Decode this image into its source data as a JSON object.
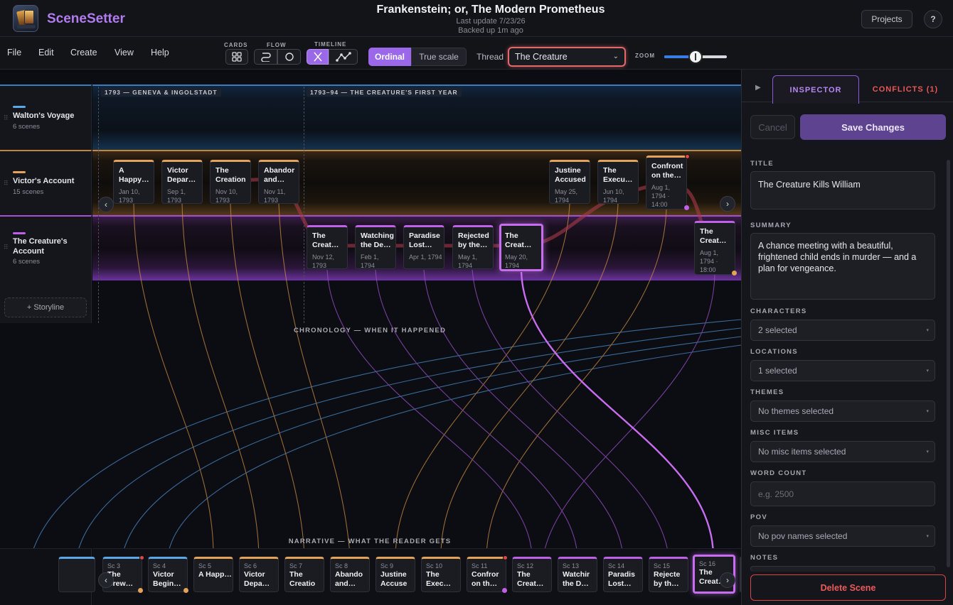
{
  "app": {
    "name": "SceneSetter"
  },
  "document": {
    "title": "Frankenstein; or, The Modern Prometheus",
    "last_update": "Last update 7/23/26",
    "backup": "Backed up 1m ago"
  },
  "header": {
    "projects_label": "Projects",
    "help_label": "?"
  },
  "menu": [
    "File",
    "Edit",
    "Create",
    "View",
    "Help"
  ],
  "toolbar": {
    "cards_label": "CARDS",
    "flow_label": "FLOW",
    "timeline_label": "TIMELINE",
    "ordinal_label": "Ordinal",
    "true_scale_label": "True scale",
    "thread_label": "Thread",
    "thread_value": "The Creature",
    "zoom_label": "ZOOM",
    "zoom_level": 0.5
  },
  "storylines": [
    {
      "name": "Walton's Voyage",
      "count": "6 scenes",
      "color": "#5aa8e8"
    },
    {
      "name": "Victor's Account",
      "count": "15 scenes",
      "color": "#e4a25a"
    },
    {
      "name": "The Creature's Account",
      "count": "6 scenes",
      "color": "#c060e8"
    }
  ],
  "add_storyline_label": "+ Storyline",
  "eras": [
    "1793 — GENEVA & INGOLSTADT",
    "1793–94 — THE CREATURE'S FIRST YEAR"
  ],
  "victor_cards": [
    {
      "title": "A Happy…",
      "date": "Jan 10, 1793"
    },
    {
      "title": "Victor Depar…",
      "date": "Sep 1, 1793"
    },
    {
      "title": "The Creation",
      "date": "Nov 10, 1793"
    },
    {
      "title": "Abandor and…",
      "date": "Nov 11, 1793"
    },
    {
      "title": "Justine Accused",
      "date": "May 25, 1794"
    },
    {
      "title": "The Execu…",
      "date": "Jun 10, 1794"
    },
    {
      "title": "Confront on the…",
      "date": "Aug 1, 1794 · 14:00"
    }
  ],
  "creature_cards": [
    {
      "title": "The Creat…",
      "date": "Nov 12, 1793"
    },
    {
      "title": "Watching the De…",
      "date": "Feb 1, 1794"
    },
    {
      "title": "Paradise Lost…",
      "date": "Apr 1, 1794"
    },
    {
      "title": "Rejected by the…",
      "date": "May 1, 1794"
    },
    {
      "title": "The Creat…",
      "date": "May 20, 1794"
    },
    {
      "title": "The Creat…",
      "date": "Aug 1, 1794 · 18:00"
    }
  ],
  "chronology_label": "CHRONOLOGY — WHEN IT HAPPENED",
  "narrative_label": "NARRATIVE — WHAT THE READER GETS",
  "narrative_cards": [
    {
      "num": "Sc 3",
      "title": "The Crew…"
    },
    {
      "num": "Sc 4",
      "title": "Victor Begin…"
    },
    {
      "num": "Sc 5",
      "title": "A Happ…"
    },
    {
      "num": "Sc 6",
      "title": "Victor Depa…"
    },
    {
      "num": "Sc 7",
      "title": "The Creatio"
    },
    {
      "num": "Sc 8",
      "title": "Abando and…"
    },
    {
      "num": "Sc 9",
      "title": "Justine Accuse"
    },
    {
      "num": "Sc 10",
      "title": "The Exec…"
    },
    {
      "num": "Sc 11",
      "title": "Confror on th…"
    },
    {
      "num": "Sc 12",
      "title": "The Creat…"
    },
    {
      "num": "Sc 13",
      "title": "Watchir the D…"
    },
    {
      "num": "Sc 14",
      "title": "Paradis Lost…"
    },
    {
      "num": "Sc 15",
      "title": "Rejecte by th…"
    },
    {
      "num": "Sc 16",
      "title": "The Creat…"
    }
  ],
  "inspector": {
    "tab_inspector": "INSPECTOR",
    "tab_conflicts": "CONFLICTS (1)",
    "cancel_label": "Cancel",
    "save_label": "Save Changes",
    "title_label": "TITLE",
    "title_value": "The Creature Kills William",
    "summary_label": "SUMMARY",
    "summary_value": "A chance meeting with a beautiful, frightened child ends in murder — and a plan for vengeance.",
    "characters_label": "CHARACTERS",
    "characters_value": "2 selected",
    "locations_label": "LOCATIONS",
    "locations_value": "1 selected",
    "themes_label": "THEMES",
    "themes_value": "No themes selected",
    "misc_label": "MISC ITEMS",
    "misc_value": "No misc items selected",
    "wordcount_label": "WORD COUNT",
    "wordcount_placeholder": "e.g. 2500",
    "pov_label": "POV",
    "pov_value": "No pov names selected",
    "notes_label": "NOTES",
    "delete_label": "Delete Scene"
  },
  "colors": {
    "accent": "#9a68e8",
    "walton": "#5aa8e8",
    "victor": "#e4a25a",
    "creature": "#c060e8",
    "danger": "#e05050"
  }
}
